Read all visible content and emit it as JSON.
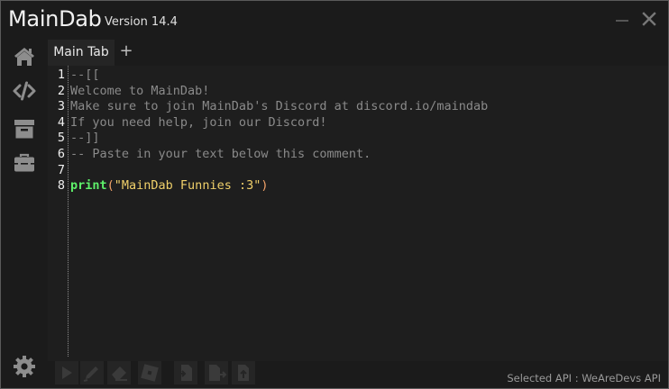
{
  "app": {
    "title": "MainDab",
    "version": "Version 14.4",
    "accent": "#5ef06a"
  },
  "sidebar": {
    "items": [
      {
        "icon": "home-icon"
      },
      {
        "icon": "code-icon"
      },
      {
        "icon": "archive-icon"
      },
      {
        "icon": "toolbox-icon"
      }
    ],
    "settings_icon": "gear-icon"
  },
  "tabs": [
    {
      "label": "Main Tab",
      "active": true
    }
  ],
  "tab_add_label": "+",
  "editor": {
    "line_numbers": [
      "1",
      "2",
      "3",
      "4",
      "5",
      "6",
      "7",
      "8"
    ],
    "lines": [
      "--[[",
      "Welcome to MainDab!",
      "Make sure to join MainDab's Discord at discord.io/maindab",
      "If you need help, join our Discord!",
      "--]]",
      "-- Paste in your text below this comment.",
      "",
      ""
    ],
    "line8": {
      "keyword": "print",
      "open_paren": "(",
      "string": "\"MainDab Funnies :3\"",
      "close_paren": ")"
    }
  },
  "toolbar": {
    "buttons": [
      "execute-icon",
      "edit-icon",
      "erase-icon",
      "roblox-icon",
      "open-file-icon",
      "save-file-icon",
      "save-as-icon"
    ]
  },
  "status": {
    "selected_api": "Selected API : WeAreDevs API"
  }
}
